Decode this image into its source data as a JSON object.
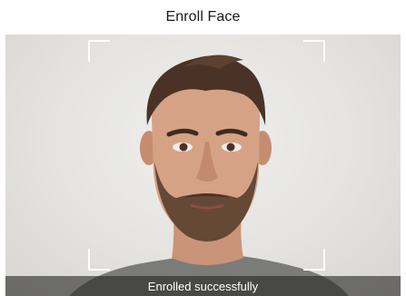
{
  "header": {
    "title": "Enroll Face"
  },
  "camera": {
    "status_message": "Enrolled successfully",
    "frame_color": "#ffffff",
    "status_bar_color": "#282828"
  },
  "icons": {
    "frame_corners": "focus-frame-corner-icon"
  }
}
